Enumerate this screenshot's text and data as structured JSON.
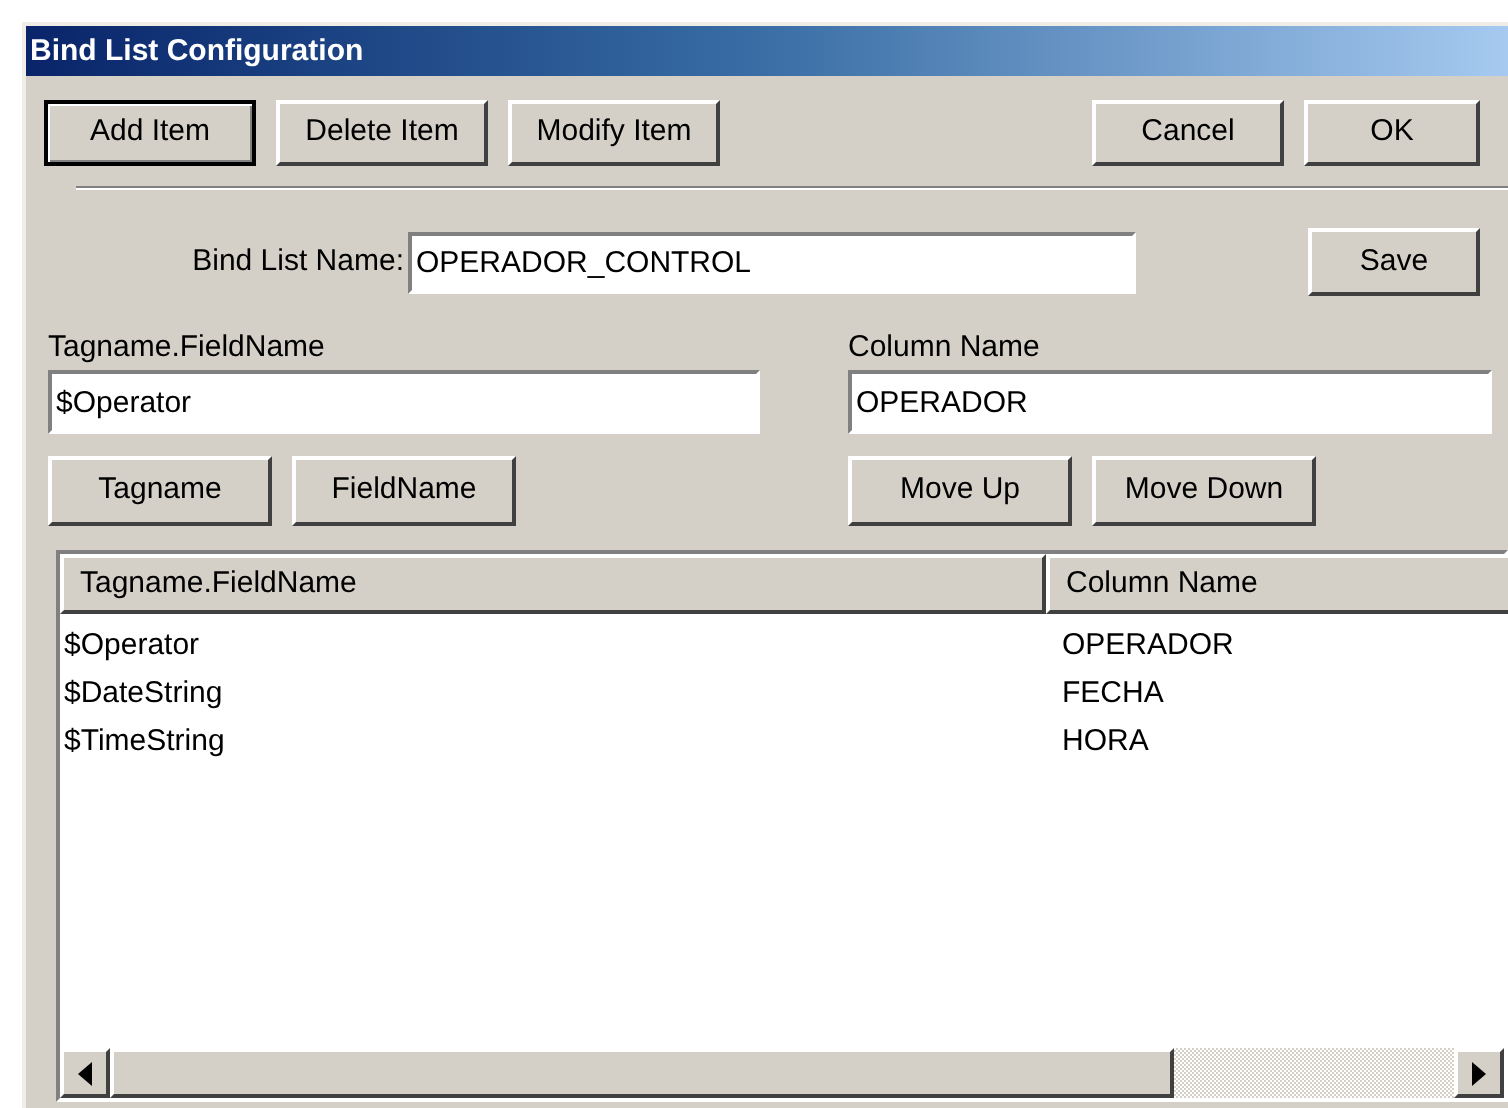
{
  "window": {
    "title": "Bind List Configuration"
  },
  "toolbar": {
    "left_buttons": [
      {
        "label": "Add Item",
        "default": true
      },
      {
        "label": "Delete Item",
        "default": false
      },
      {
        "label": "Modify Item",
        "default": false
      }
    ],
    "right_buttons": [
      {
        "label": "Cancel",
        "default": false
      },
      {
        "label": "OK",
        "default": false
      }
    ]
  },
  "bind_list": {
    "label": "Bind List Name:",
    "value": "OPERADOR_CONTROL",
    "save_button": "Save"
  },
  "tag_field": {
    "label": "Tagname.FieldName",
    "value": "$Operator",
    "buttons": [
      "Tagname",
      "FieldName"
    ]
  },
  "column_field": {
    "label": "Column Name",
    "value": "OPERADOR",
    "buttons": [
      "Move Up",
      "Move Down"
    ]
  },
  "list": {
    "columns": [
      "Tagname.FieldName",
      "Column Name"
    ],
    "rows": [
      [
        "$Operator",
        "OPERADOR"
      ],
      [
        "$DateString",
        "FECHA"
      ],
      [
        "$TimeString",
        "HORA"
      ]
    ]
  }
}
